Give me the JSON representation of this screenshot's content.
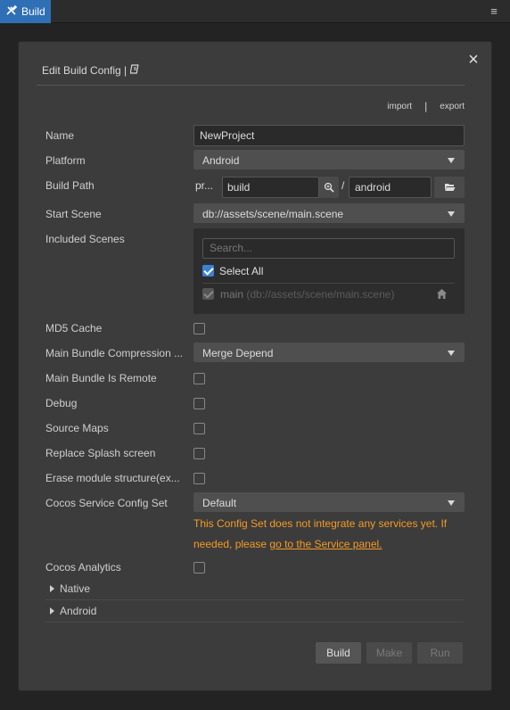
{
  "tab": {
    "label": "Build"
  },
  "dialog": {
    "title": "Edit Build Config |",
    "import_label": "import",
    "separator": "|",
    "export_label": "export"
  },
  "fields": {
    "name": {
      "label": "Name",
      "value": "NewProject"
    },
    "platform": {
      "label": "Platform",
      "value": "Android"
    },
    "build_path": {
      "label": "Build Path",
      "prefix": "pr...",
      "dir": "build",
      "slash": "/",
      "sub": "android"
    },
    "start_scene": {
      "label": "Start Scene",
      "value": "db://assets/scene/main.scene"
    },
    "included_scenes": {
      "label": "Included Scenes",
      "search_placeholder": "Search...",
      "select_all": "Select All",
      "scene_name": "main",
      "scene_path": "(db://assets/scene/main.scene)"
    },
    "md5_cache": {
      "label": "MD5 Cache",
      "checked": false
    },
    "compression": {
      "label": "Main Bundle Compression ...",
      "value": "Merge Depend"
    },
    "remote": {
      "label": "Main Bundle Is Remote",
      "checked": false
    },
    "debug": {
      "label": "Debug",
      "checked": false
    },
    "source_maps": {
      "label": "Source Maps",
      "checked": false
    },
    "splash": {
      "label": "Replace Splash screen",
      "checked": false
    },
    "erase": {
      "label": "Erase module structure(ex...",
      "checked": false
    },
    "service_config": {
      "label": "Cocos Service Config Set",
      "value": "Default"
    },
    "warning_line1": "This Config Set does not integrate any services yet. If",
    "warning_line2_prefix": "needed, please ",
    "warning_link": "go to the Service panel.",
    "analytics": {
      "label": "Cocos Analytics",
      "checked": false
    }
  },
  "sections": {
    "native": "Native",
    "android": "Android"
  },
  "buttons": {
    "build": "Build",
    "make": "Make",
    "run": "Run"
  },
  "colors": {
    "accent": "#2f6fb5",
    "warning": "#f59a23",
    "checkbox": "#3b82d6"
  }
}
